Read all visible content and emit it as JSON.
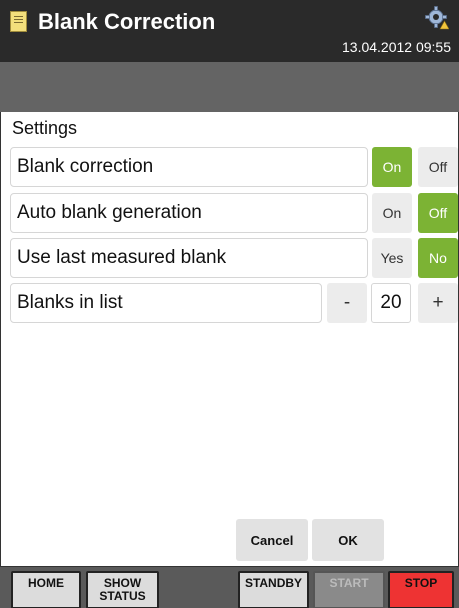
{
  "header": {
    "title": "Blank Correction",
    "datetime": "13.04.2012 09:55"
  },
  "settings": {
    "section_title": "Settings",
    "rows": [
      {
        "label": "Blank correction",
        "options": [
          "On",
          "Off"
        ],
        "selected": "On"
      },
      {
        "label": "Auto blank generation",
        "options": [
          "On",
          "Off"
        ],
        "selected": "Off"
      },
      {
        "label": "Use last measured blank",
        "options": [
          "Yes",
          "No"
        ],
        "selected": "No"
      },
      {
        "label": "Blanks in list",
        "value": "20",
        "decrement": "-",
        "increment": "+"
      }
    ]
  },
  "dialog": {
    "cancel_label": "Cancel",
    "ok_label": "OK"
  },
  "bottom_nav": {
    "home": "HOME",
    "show_status_line1": "SHOW",
    "show_status_line2": "STATUS",
    "standby": "STANDBY",
    "start": "START",
    "stop": "STOP"
  },
  "colors": {
    "selected_toggle": "#7cb334",
    "stop": "#ee3333",
    "header_bg": "#2a2a2a"
  }
}
